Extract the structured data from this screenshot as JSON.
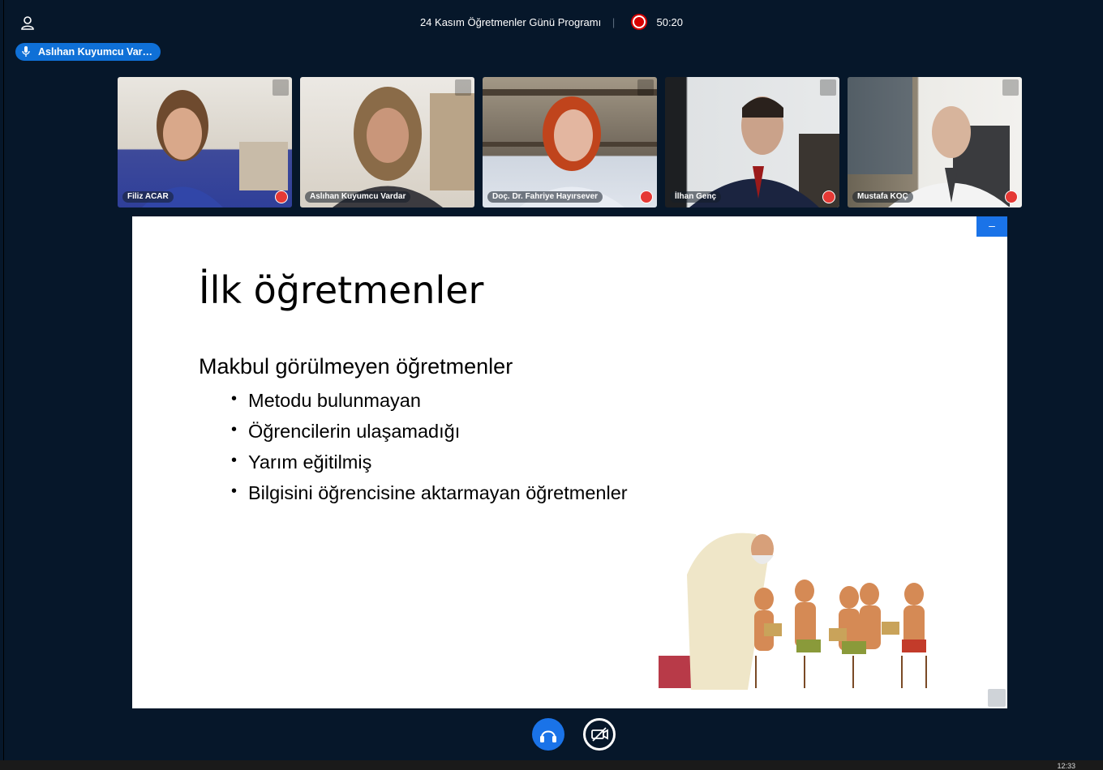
{
  "header": {
    "meeting_title": "24 Kasım Öğretmenler Günü Programı",
    "recording_time": "50:20"
  },
  "talking_indicator": {
    "label": "Aslıhan Kuyumcu Var…"
  },
  "participants": [
    {
      "name": "Filiz ACAR"
    },
    {
      "name": "Aslıhan Kuyumcu Vardar"
    },
    {
      "name": "Doç. Dr. Fahriye Hayırsever"
    },
    {
      "name": "İlhan Genç"
    },
    {
      "name": "Mustafa KOÇ"
    }
  ],
  "presentation": {
    "minimize_label": "–",
    "title": "İlk öğretmenler",
    "subtitle": "Makbul görülmeyen öğretmenler",
    "bullets": [
      "Metodu bulunmayan",
      "Öğrencilerin ulaşamadığı",
      "Yarım eğitilmiş",
      "Bilgisini öğrencisine aktarmayan öğretmenler"
    ]
  },
  "taskbar": {
    "clock": "12:33"
  },
  "colors": {
    "background": "#06172a",
    "accent": "#1a73e8",
    "recording": "#d50000"
  }
}
